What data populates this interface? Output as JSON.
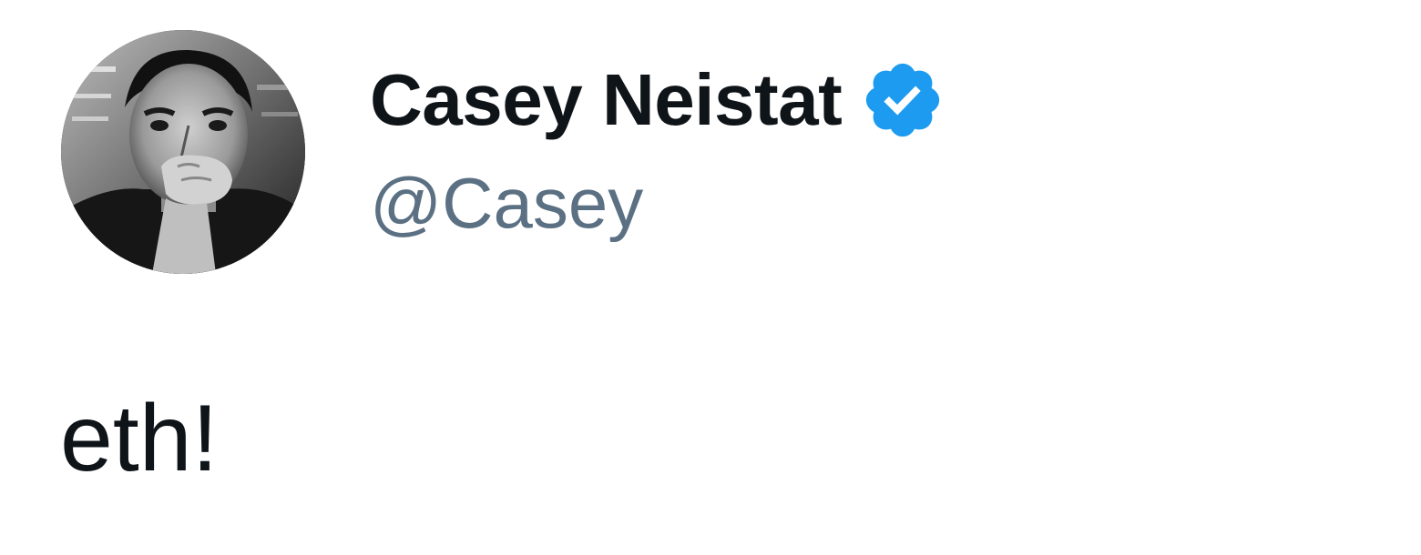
{
  "author": {
    "display_name": "Casey Neistat",
    "handle": "@Casey",
    "verified": true,
    "verified_badge_icon": "verified-badge-icon",
    "avatar_icon": "avatar-photo"
  },
  "tweet": {
    "text": "eth!"
  },
  "colors": {
    "name": "#0f1419",
    "handle": "#5b7083",
    "verified": "#1d9bf0",
    "background": "#ffffff"
  }
}
